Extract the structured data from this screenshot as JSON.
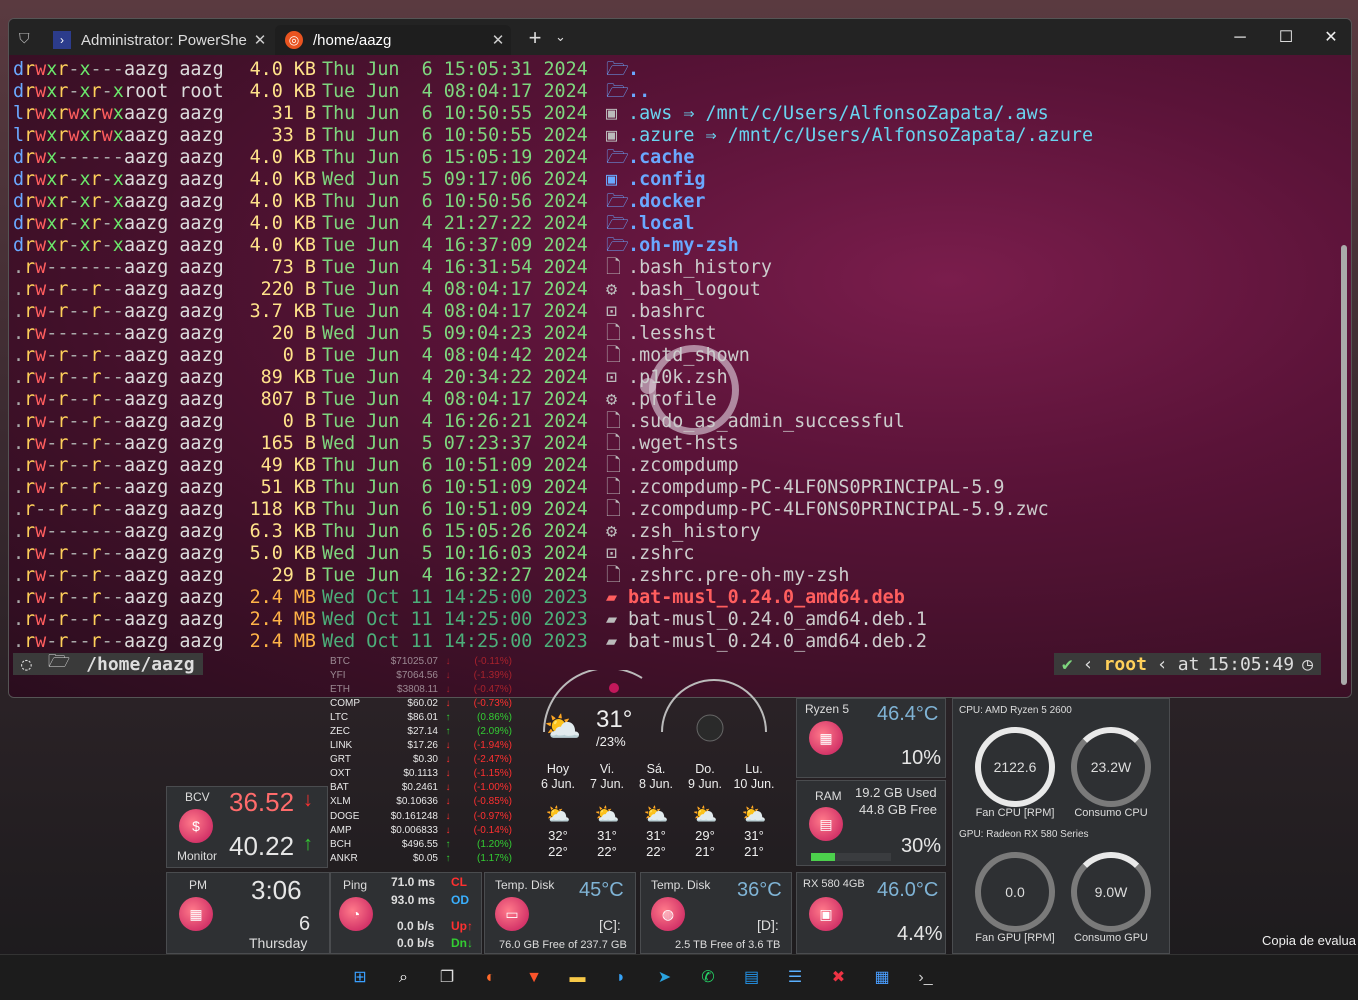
{
  "tabs": [
    {
      "label": "Administrator: PowerShe"
    },
    {
      "label": "/home/aazg"
    }
  ],
  "window_controls": {
    "new_tab": "+",
    "dropdown": "⌄",
    "minimize": "─",
    "maximize": "☐",
    "close": "✕"
  },
  "terminal": {
    "lines": [
      {
        "perm": "drwxr-x---",
        "owner": "aazg aazg",
        "size": "4.0 KB",
        "date": "Thu Jun  6 15:05:31 2024",
        "icon": "🗁",
        "name": ".",
        "kind": "dir",
        "link": ""
      },
      {
        "perm": "drwxr-xr-x",
        "owner": "root root",
        "size": "4.0 KB",
        "date": "Tue Jun  4 08:04:17 2024",
        "icon": "🗁",
        "name": "..",
        "kind": "dir",
        "link": ""
      },
      {
        "perm": "lrwxrwxrwx",
        "owner": "aazg aazg",
        "size": "31 B",
        "date": "Thu Jun  6 10:50:55 2024",
        "icon": "▣",
        "name": ".aws",
        "kind": "lnk",
        "link": "⇒ /mnt/c/Users/AlfonsoZapata/.aws"
      },
      {
        "perm": "lrwxrwxrwx",
        "owner": "aazg aazg",
        "size": "33 B",
        "date": "Thu Jun  6 10:50:55 2024",
        "icon": "▣",
        "name": ".azure",
        "kind": "lnk",
        "link": "⇒ /mnt/c/Users/AlfonsoZapata/.azure"
      },
      {
        "perm": "drwx------",
        "owner": "aazg aazg",
        "size": "4.0 KB",
        "date": "Thu Jun  6 15:05:19 2024",
        "icon": "🗁",
        "name": ".cache",
        "kind": "dir",
        "link": ""
      },
      {
        "perm": "drwxr-xr-x",
        "owner": "aazg aazg",
        "size": "4.0 KB",
        "date": "Wed Jun  5 09:17:06 2024",
        "icon": "▣",
        "name": ".config",
        "kind": "dir",
        "link": ""
      },
      {
        "perm": "drwxr-xr-x",
        "owner": "aazg aazg",
        "size": "4.0 KB",
        "date": "Thu Jun  6 10:50:56 2024",
        "icon": "🗁",
        "name": ".docker",
        "kind": "dir",
        "link": ""
      },
      {
        "perm": "drwxr-xr-x",
        "owner": "aazg aazg",
        "size": "4.0 KB",
        "date": "Tue Jun  4 21:27:22 2024",
        "icon": "🗁",
        "name": ".local",
        "kind": "dir",
        "link": ""
      },
      {
        "perm": "drwxr-xr-x",
        "owner": "aazg aazg",
        "size": "4.0 KB",
        "date": "Tue Jun  4 16:37:09 2024",
        "icon": "🗁",
        "name": ".oh-my-zsh",
        "kind": "dir",
        "link": ""
      },
      {
        "perm": ".rw-------",
        "owner": "aazg aazg",
        "size": "73 B",
        "date": "Tue Jun  4 16:31:54 2024",
        "icon": "🗋",
        "name": ".bash_history",
        "kind": "file",
        "link": ""
      },
      {
        "perm": ".rw-r--r--",
        "owner": "aazg aazg",
        "size": "220 B",
        "date": "Tue Jun  4 08:04:17 2024",
        "icon": "⚙",
        "name": ".bash_logout",
        "kind": "file",
        "link": ""
      },
      {
        "perm": ".rw-r--r--",
        "owner": "aazg aazg",
        "size": "3.7 KB",
        "date": "Tue Jun  4 08:04:17 2024",
        "icon": "⊡",
        "name": ".bashrc",
        "kind": "file",
        "link": ""
      },
      {
        "perm": ".rw-------",
        "owner": "aazg aazg",
        "size": "20 B",
        "date": "Wed Jun  5 09:04:23 2024",
        "icon": "🗋",
        "name": ".lesshst",
        "kind": "file",
        "link": ""
      },
      {
        "perm": ".rw-r--r--",
        "owner": "aazg aazg",
        "size": "0 B",
        "date": "Tue Jun  4 08:04:42 2024",
        "icon": "🗋",
        "name": ".motd_shown",
        "kind": "file",
        "link": ""
      },
      {
        "perm": ".rw-r--r--",
        "owner": "aazg aazg",
        "size": "89 KB",
        "date": "Tue Jun  4 20:34:22 2024",
        "icon": "⊡",
        "name": ".p10k.zsh",
        "kind": "file",
        "link": ""
      },
      {
        "perm": ".rw-r--r--",
        "owner": "aazg aazg",
        "size": "807 B",
        "date": "Tue Jun  4 08:04:17 2024",
        "icon": "⚙",
        "name": ".profile",
        "kind": "file",
        "link": ""
      },
      {
        "perm": ".rw-r--r--",
        "owner": "aazg aazg",
        "size": "0 B",
        "date": "Tue Jun  4 16:26:21 2024",
        "icon": "🗋",
        "name": ".sudo_as_admin_successful",
        "kind": "file",
        "link": ""
      },
      {
        "perm": ".rw-r--r--",
        "owner": "aazg aazg",
        "size": "165 B",
        "date": "Wed Jun  5 07:23:37 2024",
        "icon": "🗋",
        "name": ".wget-hsts",
        "kind": "file",
        "link": ""
      },
      {
        "perm": ".rw-r--r--",
        "owner": "aazg aazg",
        "size": "49 KB",
        "date": "Thu Jun  6 10:51:09 2024",
        "icon": "🗋",
        "name": ".zcompdump",
        "kind": "file",
        "link": ""
      },
      {
        "perm": ".rw-r--r--",
        "owner": "aazg aazg",
        "size": "51 KB",
        "date": "Thu Jun  6 10:51:09 2024",
        "icon": "🗋",
        "name": ".zcompdump-PC-4LF0NS0PRINCIPAL-5.9",
        "kind": "file",
        "link": ""
      },
      {
        "perm": ".r--r--r--",
        "owner": "aazg aazg",
        "size": "118 KB",
        "date": "Thu Jun  6 10:51:09 2024",
        "icon": "🗋",
        "name": ".zcompdump-PC-4LF0NS0PRINCIPAL-5.9.zwc",
        "kind": "file",
        "link": ""
      },
      {
        "perm": ".rw-------",
        "owner": "aazg aazg",
        "size": "6.3 KB",
        "date": "Thu Jun  6 15:05:26 2024",
        "icon": "⚙",
        "name": ".zsh_history",
        "kind": "file",
        "link": ""
      },
      {
        "perm": ".rw-r--r--",
        "owner": "aazg aazg",
        "size": "5.0 KB",
        "date": "Wed Jun  5 10:16:03 2024",
        "icon": "⊡",
        "name": ".zshrc",
        "kind": "file",
        "link": ""
      },
      {
        "perm": ".rw-r--r--",
        "owner": "aazg aazg",
        "size": "29 B",
        "date": "Tue Jun  4 16:32:27 2024",
        "icon": "🗋",
        "name": ".zshrc.pre-oh-my-zsh",
        "kind": "file",
        "link": ""
      },
      {
        "perm": ".rw-r--r--",
        "owner": "aazg aazg",
        "size": "2.4 MB",
        "date": "Wed Oct 11 14:25:00 2023",
        "icon": "▰",
        "name": "bat-musl_0.24.0_amd64.deb",
        "kind": "deb",
        "link": ""
      },
      {
        "perm": ".rw-r--r--",
        "owner": "aazg aazg",
        "size": "2.4 MB",
        "date": "Wed Oct 11 14:25:00 2023",
        "icon": "▰",
        "name": "bat-musl_0.24.0_amd64.deb.1",
        "kind": "file",
        "link": ""
      },
      {
        "perm": ".rw-r--r--",
        "owner": "aazg aazg",
        "size": "2.4 MB",
        "date": "Wed Oct 11 14:25:00 2023",
        "icon": "▰",
        "name": "bat-musl_0.24.0_amd64.deb.2",
        "kind": "file",
        "link": ""
      }
    ],
    "prompt": {
      "os_icon": "◌",
      "dir_icon": "🗁",
      "path": "/home/aazg",
      "check": "✔",
      "user": "root",
      "at": "at",
      "time": "15:05:49",
      "clock_icon": "◷"
    }
  },
  "crypto": [
    {
      "sym": "BTC",
      "price": "$71025.07",
      "dir": "down",
      "chg": "(-0.11%)"
    },
    {
      "sym": "YFI",
      "price": "$7064.56",
      "dir": "down",
      "chg": "(-1.39%)"
    },
    {
      "sym": "ETH",
      "price": "$3808.11",
      "dir": "down",
      "chg": "(-0.47%)"
    },
    {
      "sym": "COMP",
      "price": "$60.02",
      "dir": "down",
      "chg": "(-0.73%)"
    },
    {
      "sym": "LTC",
      "price": "$86.01",
      "dir": "up",
      "chg": "(0.86%)"
    },
    {
      "sym": "ZEC",
      "price": "$27.14",
      "dir": "up",
      "chg": "(2.09%)"
    },
    {
      "sym": "LINK",
      "price": "$17.26",
      "dir": "down",
      "chg": "(-1.94%)"
    },
    {
      "sym": "GRT",
      "price": "$0.30",
      "dir": "down",
      "chg": "(-2.47%)"
    },
    {
      "sym": "OXT",
      "price": "$0.1113",
      "dir": "down",
      "chg": "(-1.15%)"
    },
    {
      "sym": "BAT",
      "price": "$0.2461",
      "dir": "down",
      "chg": "(-1.00%)"
    },
    {
      "sym": "XLM",
      "price": "$0.10636",
      "dir": "down",
      "chg": "(-0.85%)"
    },
    {
      "sym": "DOGE",
      "price": "$0.161248",
      "dir": "down",
      "chg": "(-0.97%)"
    },
    {
      "sym": "AMP",
      "price": "$0.006833",
      "dir": "down",
      "chg": "(-0.14%)"
    },
    {
      "sym": "BCH",
      "price": "$496.55",
      "dir": "up",
      "chg": "(1.20%)"
    },
    {
      "sym": "ANKR",
      "price": "$0.05",
      "dir": "up",
      "chg": "(1.17%)"
    }
  ],
  "bcv": {
    "label": "BCV",
    "value": "36.52",
    "arrow": "↓",
    "monitor_label": "Monitor",
    "monitor_value": "40.22",
    "monitor_arrow": "↑"
  },
  "weather": {
    "temp": "31°",
    "range": "/23%",
    "days": [
      {
        "name": "Hoy",
        "date": "6 Jun.",
        "hi": "32°",
        "lo": "22°"
      },
      {
        "name": "Vi.",
        "date": "7 Jun.",
        "hi": "31°",
        "lo": "22°"
      },
      {
        "name": "Sá.",
        "date": "8 Jun.",
        "hi": "31°",
        "lo": "22°"
      },
      {
        "name": "Do.",
        "date": "9 Jun.",
        "hi": "29°",
        "lo": "21°"
      },
      {
        "name": "Lu.",
        "date": "10 Jun.",
        "hi": "31°",
        "lo": "21°"
      }
    ]
  },
  "cpu": {
    "name": "Ryzen 5",
    "temp": "46.4°C",
    "load": "10%"
  },
  "ram": {
    "label": "RAM",
    "used": "19.2 GB Used",
    "free": "44.8 GB Free",
    "pct": "30%",
    "fill": 0.3
  },
  "cpu_gauges": {
    "title": "CPU: AMD Ryzen 5 2600",
    "fan_value": "2122.6",
    "fan_label": "Fan CPU [RPM]",
    "power_value": "23.2W",
    "power_label": "Consumo CPU"
  },
  "gpu_gauges": {
    "title": "GPU: Radeon RX 580 Series",
    "fan_value": "0.0",
    "fan_label": "Fan GPU [RPM]",
    "power_value": "9.0W",
    "power_label": "Consumo GPU"
  },
  "clock": {
    "label": "PM",
    "time": "3:06",
    "day": "6",
    "weekday": "Thursday"
  },
  "ping": {
    "label": "Ping",
    "cl_ms": "71.0 ms",
    "cl": "CL",
    "od_ms": "93.0 ms",
    "od": "OD",
    "up": "0.0 b/s",
    "up_label": "Up↑",
    "down": "0.0 b/s",
    "down_label": "Dn↓"
  },
  "disk1": {
    "label": "Temp. Disk",
    "temp": "45°C",
    "drive": "[C]:",
    "free": "76.0 GB Free of 237.7 GB"
  },
  "disk2": {
    "label": "Temp. Disk",
    "temp": "36°C",
    "drive": "[D]:",
    "free": "2.5 TB Free of 3.6 TB"
  },
  "gpu": {
    "name": "RX 580 4GB",
    "temp": "46.0°C",
    "load": "4.4%"
  },
  "watermark": "Copia de evalua",
  "taskbar": [
    "start-icon",
    "search-icon",
    "task-view-icon",
    "app-icon",
    "brave-icon",
    "file-explorer-icon",
    "edge-icon",
    "telegram-icon",
    "whatsapp-icon",
    "docker-icon",
    "notepad-icon",
    "xbox-icon",
    "store-icon",
    "terminal-icon"
  ],
  "colors": {
    "accent": "#c2185b",
    "dir": "#6aa8ff",
    "date": "#7ed67e",
    "deb": "#ff5e5e"
  }
}
